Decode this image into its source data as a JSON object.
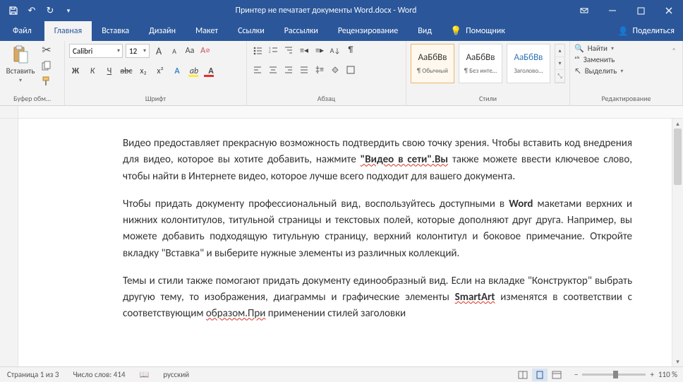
{
  "title": "Принтер не печатает документы Word.docx  -  Word",
  "tabs": {
    "file": "Файл",
    "home": "Главная",
    "insert": "Вставка",
    "design": "Дизайн",
    "layout": "Макет",
    "references": "Ссылки",
    "mailings": "Рассылки",
    "review": "Рецензирование",
    "view": "Вид"
  },
  "help_text": "Помощник",
  "share": "Поделиться",
  "groups": {
    "clipboard": "Буфер обм…",
    "font": "Шрифт",
    "paragraph": "Абзац",
    "styles": "Стили",
    "editing": "Редактирование"
  },
  "clipboard": {
    "paste": "Вставить"
  },
  "font": {
    "name": "Calibri",
    "size": "12",
    "bold": "Ж",
    "italic": "К",
    "underline": "Ч",
    "strike": "abc",
    "sub": "x₂",
    "sup": "x²",
    "bigA": "A",
    "smallA": "A",
    "Aa": "Aa",
    "clear": "A"
  },
  "styles_gallery": [
    {
      "sample": "АаБбВв",
      "label": "¶ Обычный",
      "blue": false
    },
    {
      "sample": "АаБбВв",
      "label": "¶ Без инте…",
      "blue": false
    },
    {
      "sample": "АаБбВв",
      "label": "Заголово…",
      "blue": true
    }
  ],
  "editing": {
    "find": "Найти",
    "replace": "Заменить",
    "select": "Выделить"
  },
  "doc": {
    "p1_a": "Видео предоставляет прекрасную возможность подтвердить свою точку зрения. Чтобы вставить код внедрения для видео, которое вы хотите добавить, нажмите ",
    "p1_b": "\"Видео в сети\".Вы",
    "p1_c": " также можете ввести ключевое слово, чтобы найти в Интернете видео, которое лучше всего подходит для вашего документа.",
    "p2_a": "Чтобы придать документу профессиональный вид, воспользуйтесь доступными в ",
    "p2_b": "Word",
    "p2_c": " макетами верхних и нижних колонтитулов, титульной страницы и текстовых полей, которые дополняют друг друга. Например, вы можете добавить подходящую титульную страницу, верхний колонтитул и боковое примечание. Откройте вкладку \"Вставка\" и выберите нужные элементы из различных коллекций.",
    "p3_a": "Темы и стили также помогают придать документу единообразный вид. Если на вкладке \"Конструктор\" выбрать другую тему, то изображения, диаграммы и графические элементы ",
    "p3_b": "SmartArt",
    "p3_c": " изменятся в соответствии с соответствующим ",
    "p3_d": "образом.При",
    "p3_e": " применении стилей заголовки"
  },
  "status": {
    "page": "Страница 1 из 3",
    "words": "Число слов: 414",
    "lang": "русский",
    "zoom": "110 %",
    "minus": "−",
    "plus": "+"
  }
}
